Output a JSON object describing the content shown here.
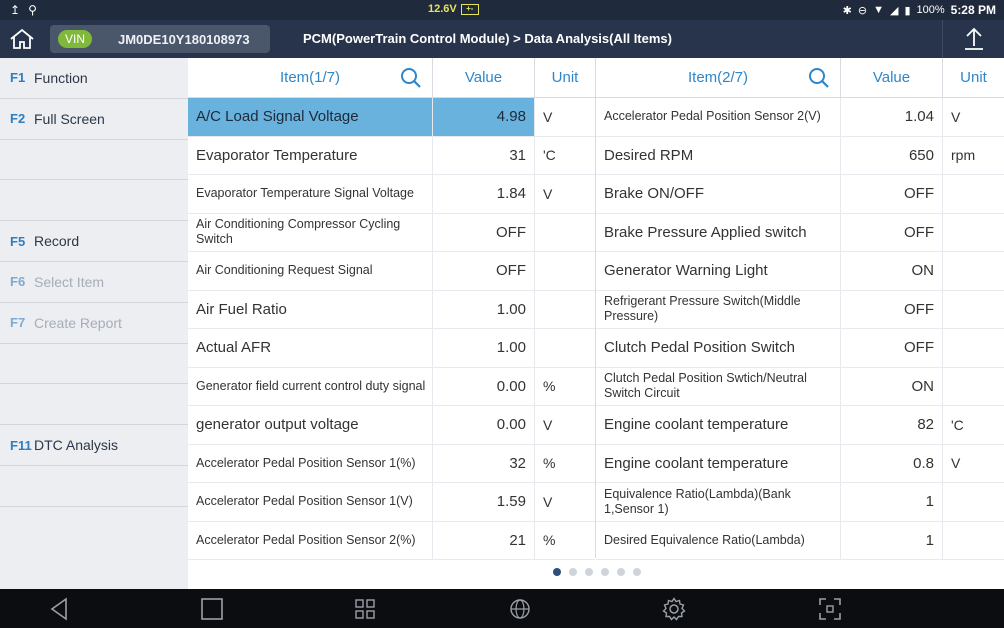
{
  "status_bar": {
    "voltage": "12.6V",
    "battery_percent": "100%",
    "time": "5:28 PM"
  },
  "header": {
    "vin_label": "VIN",
    "vin_value": "JM0DE10Y180108973",
    "breadcrumb": "PCM(PowerTrain Control Module)  >  Data Analysis(All Items)"
  },
  "sidebar": {
    "items": [
      {
        "key": "F1",
        "label": "Function",
        "enabled": true
      },
      {
        "key": "F2",
        "label": "Full Screen",
        "enabled": true
      },
      {
        "key": "",
        "label": "",
        "enabled": true
      },
      {
        "key": "",
        "label": "",
        "enabled": true
      },
      {
        "key": "F5",
        "label": "Record",
        "enabled": true
      },
      {
        "key": "F6",
        "label": "Select Item",
        "enabled": false
      },
      {
        "key": "F7",
        "label": "Create Report",
        "enabled": false
      },
      {
        "key": "",
        "label": "",
        "enabled": true
      },
      {
        "key": "",
        "label": "",
        "enabled": true
      },
      {
        "key": "F11",
        "label": "DTC Analysis",
        "enabled": true
      },
      {
        "key": "",
        "label": "",
        "enabled": true
      },
      {
        "key": "",
        "label": "",
        "enabled": true
      }
    ]
  },
  "table1": {
    "header": {
      "item": "Item(1/7)",
      "value": "Value",
      "unit": "Unit"
    },
    "rows": [
      {
        "item": "A/C Load Signal Voltage",
        "value": "4.98",
        "unit": "V"
      },
      {
        "item": "Evaporator Temperature",
        "value": "31",
        "unit": "'C"
      },
      {
        "item": "Evaporator Temperature Signal Voltage",
        "value": "1.84",
        "unit": "V"
      },
      {
        "item": "Air Conditioning Compressor Cycling Switch",
        "value": "OFF",
        "unit": ""
      },
      {
        "item": "Air Conditioning Request Signal",
        "value": "OFF",
        "unit": ""
      },
      {
        "item": "Air Fuel Ratio",
        "value": "1.00",
        "unit": ""
      },
      {
        "item": "Actual AFR",
        "value": "1.00",
        "unit": ""
      },
      {
        "item": "Generator field current control duty signal",
        "value": "0.00",
        "unit": "%"
      },
      {
        "item": "generator output voltage",
        "value": "0.00",
        "unit": "V"
      },
      {
        "item": "Accelerator Pedal Position Sensor 1(%)",
        "value": "32",
        "unit": "%"
      },
      {
        "item": "Accelerator Pedal Position Sensor 1(V)",
        "value": "1.59",
        "unit": "V"
      },
      {
        "item": "Accelerator Pedal Position Sensor 2(%)",
        "value": "21",
        "unit": "%"
      }
    ]
  },
  "table2": {
    "header": {
      "item": "Item(2/7)",
      "value": "Value",
      "unit": "Unit"
    },
    "rows": [
      {
        "item": "Accelerator Pedal Position Sensor 2(V)",
        "value": "1.04",
        "unit": "V"
      },
      {
        "item": "Desired RPM",
        "value": "650",
        "unit": "rpm"
      },
      {
        "item": "Brake ON/OFF",
        "value": "OFF",
        "unit": ""
      },
      {
        "item": "Brake Pressure Applied switch",
        "value": "OFF",
        "unit": ""
      },
      {
        "item": "Generator Warning Light",
        "value": "ON",
        "unit": ""
      },
      {
        "item": "Refrigerant Pressure Switch(Middle Pressure)",
        "value": "OFF",
        "unit": ""
      },
      {
        "item": "Clutch Pedal Position Switch",
        "value": "OFF",
        "unit": ""
      },
      {
        "item": "Clutch Pedal Position Swtich/Neutral Switch Circuit",
        "value": "ON",
        "unit": ""
      },
      {
        "item": "Engine coolant temperature",
        "value": "82",
        "unit": "'C"
      },
      {
        "item": "Engine coolant temperature",
        "value": "0.8",
        "unit": "V"
      },
      {
        "item": "Equivalence Ratio(Lambda)(Bank 1,Sensor 1)",
        "value": "1",
        "unit": ""
      },
      {
        "item": "Desired Equivalence Ratio(Lambda)",
        "value": "1",
        "unit": ""
      }
    ]
  },
  "pagination": {
    "total": 6,
    "current": 1
  },
  "colors": {
    "accent": "#2e86c9",
    "selected_row": "#69b2de",
    "vin_badge": "#7fb83a",
    "titlebar": "#27344b",
    "voltage": "#e7e35a"
  }
}
